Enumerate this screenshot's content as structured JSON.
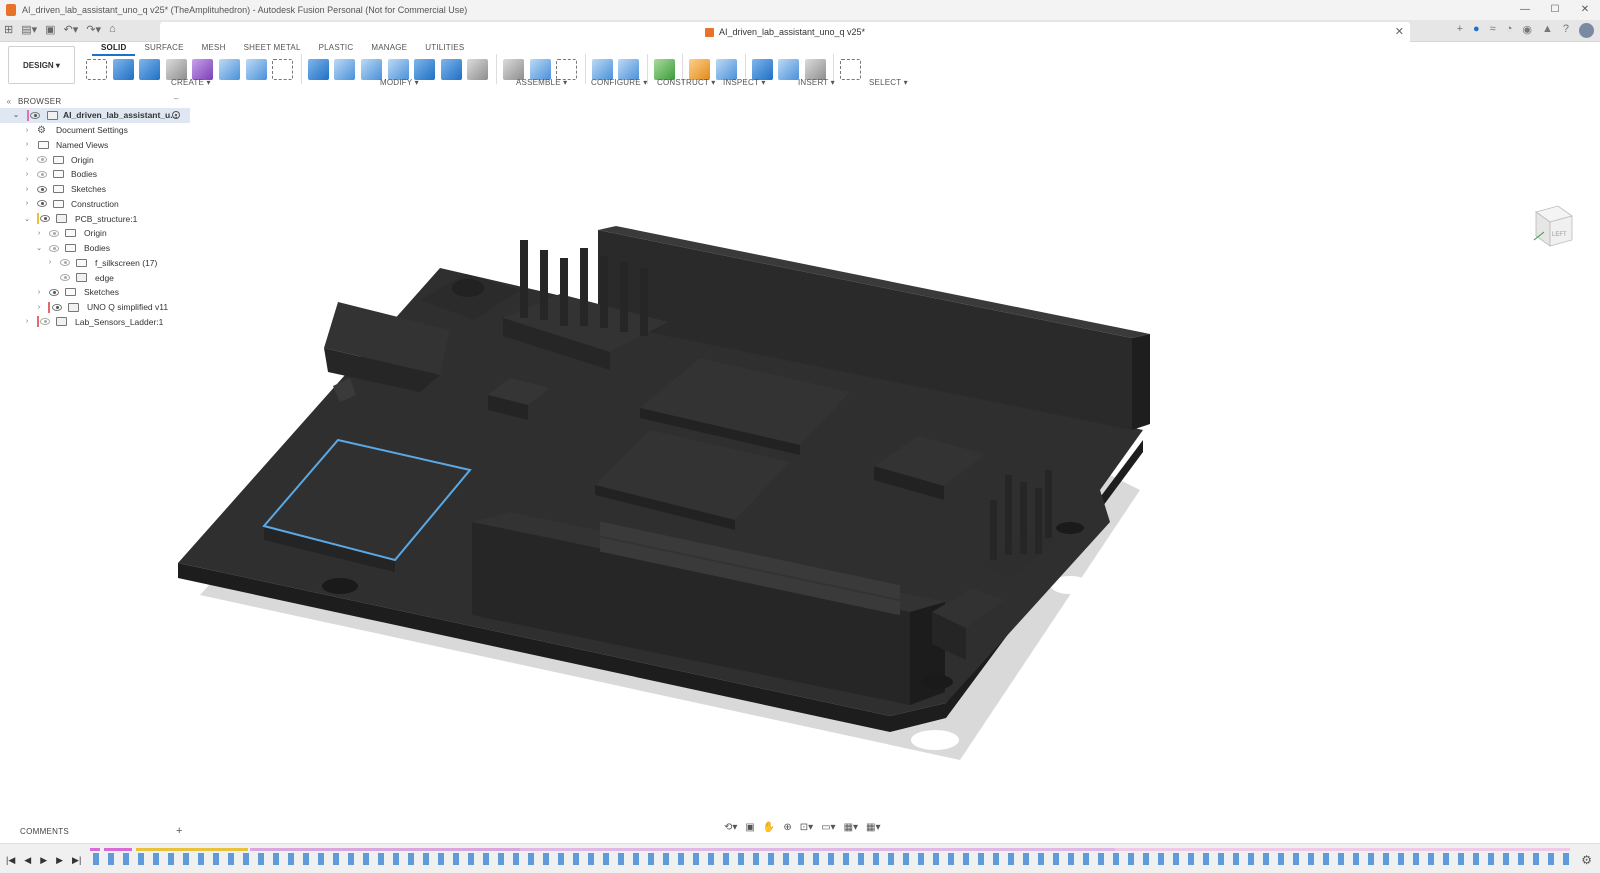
{
  "window": {
    "title": "AI_driven_lab_assistant_uno_q v25* (TheAmplituhedron) - Autodesk Fusion Personal (Not for Commercial Use)",
    "controls": [
      "—",
      "☐",
      "✕"
    ]
  },
  "doc_tab": {
    "title": "AI_driven_lab_assistant_uno_q v25*",
    "close": "✕"
  },
  "toolbar": {
    "workspace": "DESIGN ▾",
    "tabs": [
      "SOLID",
      "SURFACE",
      "MESH",
      "SHEET METAL",
      "PLASTIC",
      "MANAGE",
      "UTILITIES"
    ],
    "groups": [
      "CREATE ▾",
      "MODIFY ▾",
      "ASSEMBLE ▾",
      "CONFIGURE ▾",
      "CONSTRUCT ▾",
      "INSPECT ▾",
      "INSERT ▾",
      "SELECT ▾"
    ]
  },
  "browser": {
    "title": "BROWSER",
    "items": [
      {
        "label": "AI_driven_lab_assistant_u..."
      },
      {
        "label": "Document Settings"
      },
      {
        "label": "Named Views"
      },
      {
        "label": "Origin"
      },
      {
        "label": "Bodies"
      },
      {
        "label": "Sketches"
      },
      {
        "label": "Construction"
      },
      {
        "label": "PCB_structure:1"
      },
      {
        "label": "Origin"
      },
      {
        "label": "Bodies"
      },
      {
        "label": "f_silkscreen (17)"
      },
      {
        "label": "edge"
      },
      {
        "label": "Sketches"
      },
      {
        "label": "UNO Q simplified v11"
      },
      {
        "label": "Lab_Sensors_Ladder:1"
      }
    ]
  },
  "viewcube": {
    "face": "LEFT"
  },
  "comments": {
    "title": "COMMENTS",
    "add": "+"
  },
  "colors": {
    "accent": "#1a73c8",
    "board": "#2e2e2e",
    "selection": "#5aa9e6"
  }
}
